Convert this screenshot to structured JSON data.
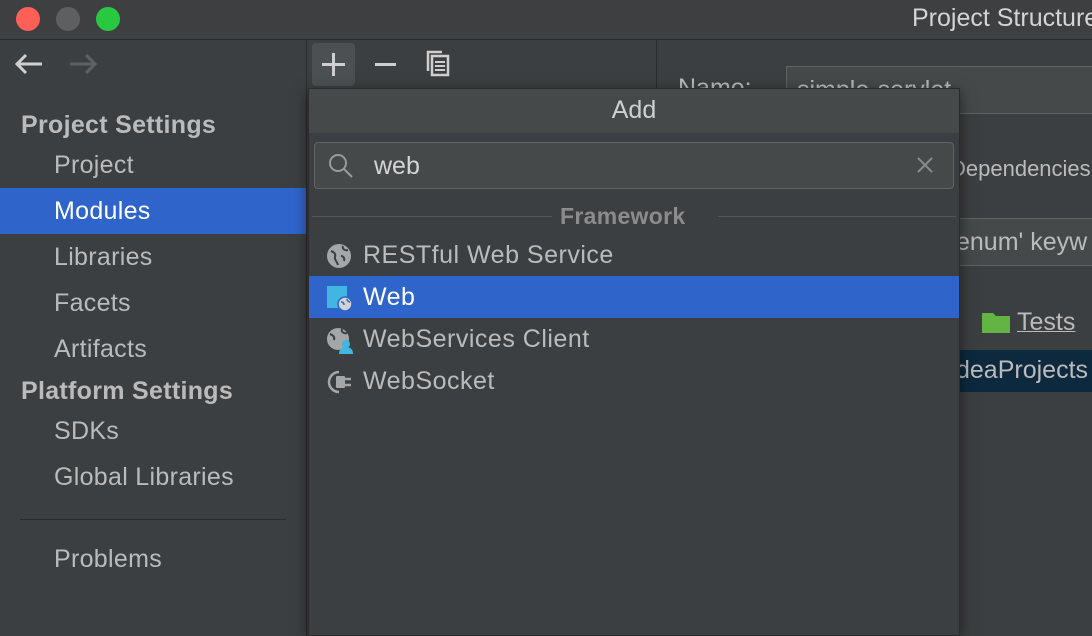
{
  "window": {
    "title": "Project Structure",
    "traffic_lights": {
      "close": "#fe5f57",
      "minimize": "#5d5f61",
      "maximize": "#28c940"
    }
  },
  "nav": {
    "back_icon": "arrow-left-icon",
    "forward_icon": "arrow-right-icon"
  },
  "sidebar": {
    "project_settings_header": "Project Settings",
    "project_items": [
      "Project",
      "Modules",
      "Libraries",
      "Facets",
      "Artifacts"
    ],
    "selected_item": "Modules",
    "platform_settings_header": "Platform Settings",
    "platform_items": [
      "SDKs",
      "Global Libraries"
    ],
    "problems": "Problems"
  },
  "toolbar": {
    "add_icon": "plus-icon",
    "remove_icon": "minus-icon",
    "copy_icon": "copy-icon"
  },
  "module_panel": {
    "name_label": "Name:",
    "name_value": "simple-servlet",
    "dependencies_tab": "Dependencies",
    "enum_text": "enum' keyw",
    "tests_label": "Tests",
    "path_text": "deaProjects"
  },
  "popup": {
    "title": "Add",
    "search": {
      "value": "web",
      "icon": "search-icon",
      "clear_icon": "close-icon"
    },
    "group_label": "Framework",
    "options": [
      {
        "label": "RESTful Web Service",
        "icon": "globe-icon"
      },
      {
        "label": "Web",
        "icon": "web-module-icon"
      },
      {
        "label": "WebServices Client",
        "icon": "globe-user-icon"
      },
      {
        "label": "WebSocket",
        "icon": "plug-icon"
      }
    ],
    "selected_option": "Web"
  },
  "colors": {
    "selection": "#2f65ca",
    "background": "#3c3f41",
    "tests_folder": "#62b543",
    "path_row": "#0d293e"
  }
}
